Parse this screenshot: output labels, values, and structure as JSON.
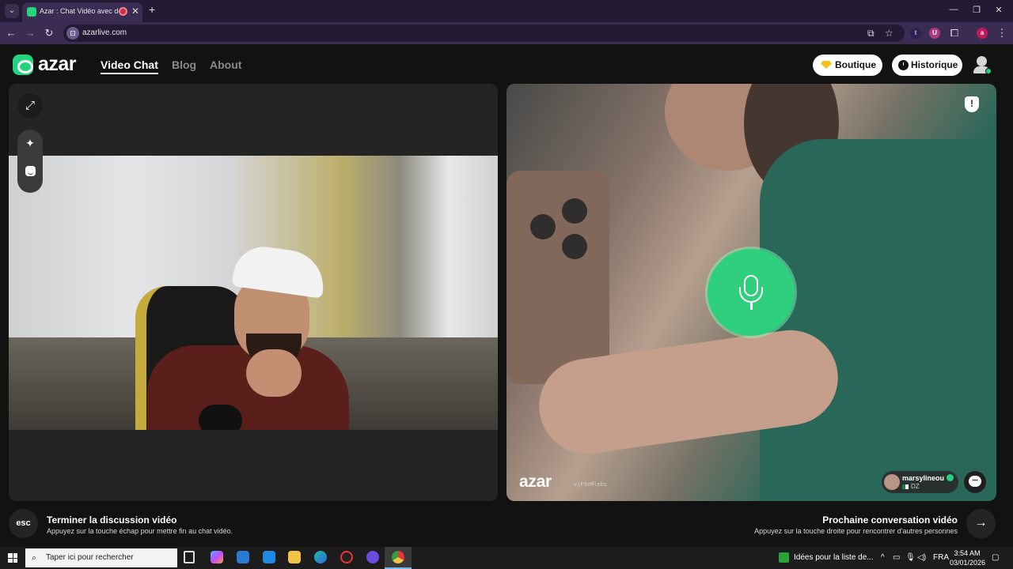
{
  "browser": {
    "tab_title": "Azar : Chat Vidéo avec de n",
    "tab_close": "✕",
    "new_tab": "+",
    "url": "azarlive.com",
    "win_min": "—",
    "win_max": "❐",
    "win_close": "✕",
    "ext_t": "t",
    "ext_u": "U",
    "ext_profile": "a"
  },
  "header": {
    "logo": "azar",
    "nav": [
      "Video Chat",
      "Blog",
      "About"
    ],
    "shop_label": "Boutique",
    "history_label": "Historique"
  },
  "remote": {
    "watermark": "azar",
    "watermark_id": "vjF9zMlebs",
    "username": "marsylineou",
    "country": "DZ"
  },
  "footer": {
    "esc_key": "esc",
    "end_title": "Terminer la discussion vidéo",
    "end_sub": "Appuyez sur la touche échap pour mettre fin au chat vidéo.",
    "next_title": "Prochaine conversation vidéo",
    "next_sub": "Appuyez sur la touche droite pour rencontrer d'autres personnes",
    "next_arrow": "→"
  },
  "taskbar": {
    "search_placeholder": "Taper ici pour rechercher",
    "news": "Idées pour la liste de...",
    "lang": "FRA",
    "time": "3:54 AM",
    "date": "03/01/2026"
  },
  "colors": {
    "brand_green": "#22d47e",
    "background": "#121212",
    "browser_chrome": "#3a2c52"
  }
}
